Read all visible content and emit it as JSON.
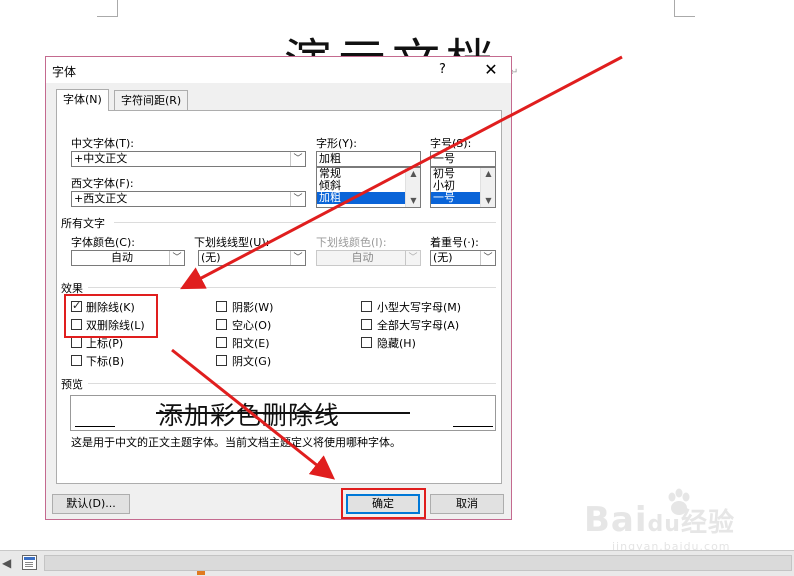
{
  "document": {
    "title": "演示文档",
    "paragraph_mark": "↵"
  },
  "dialog": {
    "title": "字体",
    "help": "?",
    "close": "✕",
    "tabs": [
      {
        "label": "字体(N)",
        "active": true
      },
      {
        "label": "字符间距(R)",
        "active": false
      }
    ],
    "cn_font": {
      "label": "中文字体(T):",
      "value": "+中文正文"
    },
    "west_font": {
      "label": "西文字体(F):",
      "value": "+西文正文"
    },
    "style": {
      "label": "字形(Y):",
      "value": "加粗",
      "options": [
        "常规",
        "倾斜",
        "加粗"
      ],
      "selected_index": 2
    },
    "size": {
      "label": "字号(S):",
      "value": "一号",
      "options": [
        "初号",
        "小初",
        "一号"
      ],
      "selected_index": 2
    },
    "all_text": {
      "section_label": "所有文字",
      "font_color": {
        "label": "字体颜色(C):",
        "value": "自动"
      },
      "underline_style": {
        "label": "下划线线型(U):",
        "value": "(无)"
      },
      "underline_color": {
        "label": "下划线颜色(I):",
        "value": "自动",
        "disabled": true
      },
      "emphasis": {
        "label": "着重号(·):",
        "value": "(无)"
      }
    },
    "effects": {
      "section_label": "效果",
      "items": [
        {
          "label": "删除线(K)",
          "checked": true
        },
        {
          "label": "双删除线(L)",
          "checked": false
        },
        {
          "label": "上标(P)",
          "checked": false
        },
        {
          "label": "下标(B)",
          "checked": false
        },
        {
          "label": "阴影(W)",
          "checked": false
        },
        {
          "label": "空心(O)",
          "checked": false
        },
        {
          "label": "阳文(E)",
          "checked": false
        },
        {
          "label": "阴文(G)",
          "checked": false
        },
        {
          "label": "小型大写字母(M)",
          "checked": false
        },
        {
          "label": "全部大写字母(A)",
          "checked": false
        },
        {
          "label": "隐藏(H)",
          "checked": false
        }
      ]
    },
    "preview": {
      "section_label": "预览",
      "sample_text": "添加彩色删除线",
      "note": "这是用于中文的正文主题字体。当前文档主题定义将使用哪种字体。"
    },
    "buttons": {
      "default": "默认(D)...",
      "ok": "确定",
      "cancel": "取消"
    }
  },
  "watermark": {
    "brand": "Bai",
    "brand_tail": "经验",
    "url": "jingyan.baidu.com"
  },
  "annotation_color": "#e01e1e"
}
